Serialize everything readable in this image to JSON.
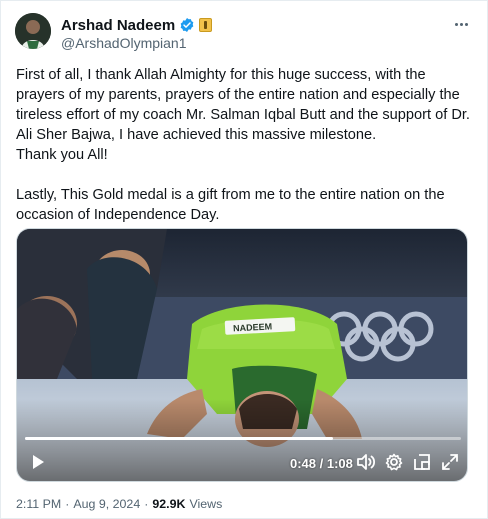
{
  "author": {
    "display_name": "Arshad Nadeem",
    "handle": "@ArshadOlympian1",
    "verified_icon": "verified-badge-icon",
    "affiliate_icon": "affiliate-badge-icon"
  },
  "tweet": {
    "paragraph_1": "First of all, I thank Allah Almighty for this huge success, with the prayers of my parents, prayers of the entire nation and especially the tireless effort of my coach Mr. Salman Iqbal Butt and the support of Dr. Ali Sher Bajwa, I have achieved this massive milestone.",
    "paragraph_2": "Thank you All!",
    "paragraph_3": "Lastly, This Gold medal is a gift from me to the entire nation on the occasion of Independence Day."
  },
  "video": {
    "time_display": "0:48 / 1:08",
    "progress": 0.706,
    "bib_text": "NADEEM",
    "controls": [
      "play-icon",
      "volume-icon",
      "settings-gear-icon",
      "picture-in-picture-icon",
      "fullscreen-icon"
    ]
  },
  "footer": {
    "time": "2:11 PM",
    "separator": "·",
    "date": "Aug 9, 2024",
    "views_count": "92.9K",
    "views_label": "Views"
  },
  "colors": {
    "text_primary": "#0f1419",
    "text_secondary": "#536471",
    "verified_blue": "#1d9bf0",
    "jersey_green": "#8fd43a"
  }
}
